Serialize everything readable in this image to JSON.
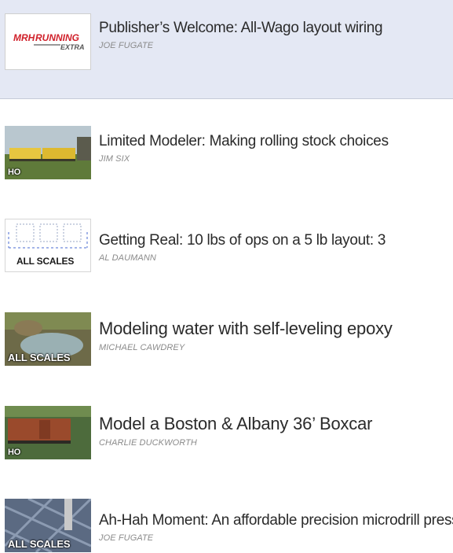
{
  "articles": [
    {
      "title": "Publisher’s Welcome: All-Wago layout wiring",
      "author": "JOE FUGATE",
      "thumb": "logo-thumbnail",
      "logo_top": "MRH",
      "logo_mid": "RUNNING",
      "logo_bottom": "EXTRA",
      "selected": true
    },
    {
      "title": "Limited Modeler: Making rolling stock choices",
      "author": "JIM SIX",
      "thumb": "yellow-cars-photo",
      "scale": "HO"
    },
    {
      "title": "Getting Real: 10 lbs of ops on a 5 lb layout: 3",
      "author": "AL DAUMANN",
      "thumb": "diagram-thumbnail",
      "scale": "ALL SCALES"
    },
    {
      "title": "Modeling water with self-leveling epoxy",
      "author": "MICHAEL CAWDREY",
      "thumb": "water-scene-photo",
      "scale": "ALL SCALES"
    },
    {
      "title": "Model a Boston & Albany 36’ Boxcar",
      "author": "CHARLIE DUCKWORTH",
      "thumb": "boxcar-photo",
      "scale": "HO"
    },
    {
      "title": "Ah-Hah Moment: An affordable precision microdrill press",
      "author": "JOE FUGATE",
      "thumb": "drill-press-photo",
      "scale": "ALL SCALES"
    }
  ],
  "colors": {
    "selected_background": "#e4e8f4",
    "title": "#2a2a2a",
    "author": "#8a8a8a",
    "logo_red": "#d0202a"
  }
}
